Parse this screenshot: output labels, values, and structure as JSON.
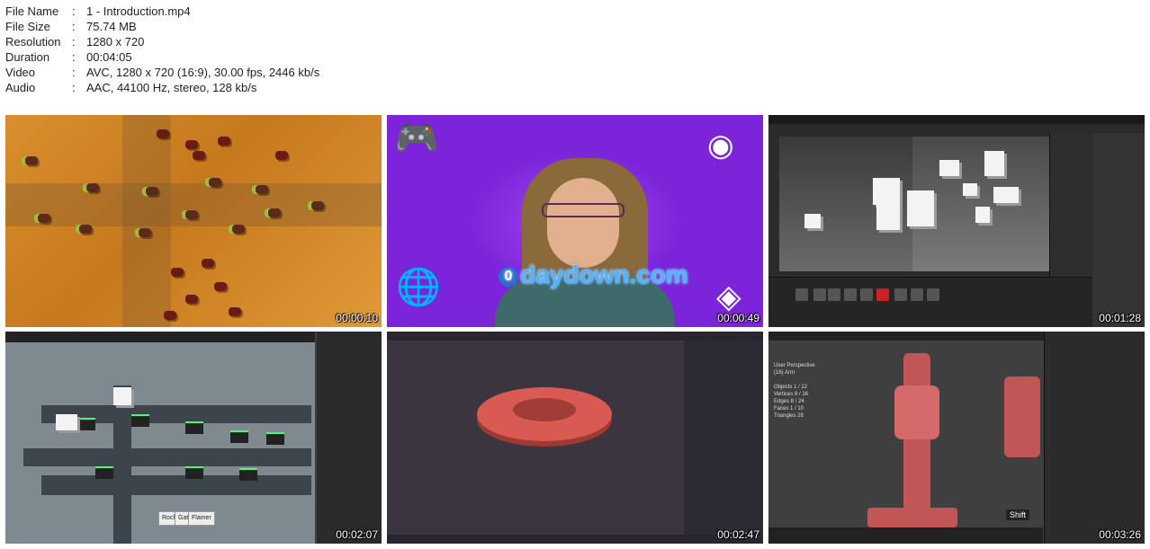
{
  "file_info": [
    {
      "label": "File Name",
      "value": "1 - Introduction.mp4"
    },
    {
      "label": "File Size",
      "value": "75.74 MB"
    },
    {
      "label": "Resolution",
      "value": "1280 x 720"
    },
    {
      "label": "Duration",
      "value": "00:04:05"
    },
    {
      "label": "Video",
      "value": "AVC, 1280 x 720 (16:9), 30.00 fps, 2446 kb/s"
    },
    {
      "label": "Audio",
      "value": "AAC, 44100 Hz, stereo, 128 kb/s"
    }
  ],
  "separator": ":",
  "thumbnails": [
    {
      "timestamp": "00:00:10"
    },
    {
      "timestamp": "00:00:49",
      "brand_text": "daydown.com",
      "brand_mark": "0"
    },
    {
      "timestamp": "00:01:28"
    },
    {
      "timestamp": "00:02:07",
      "buttons": [
        "Rocket",
        "Gatling",
        "Flamer"
      ]
    },
    {
      "timestamp": "00:02:47"
    },
    {
      "timestamp": "00:03:26",
      "key_hint": "Shift",
      "viewport_info": "User Perspective\n(16) Arm\n\nObjects 1 / 12\nVertices 8 / 16\nEdges 8 / 24\nFaces 1 / 10\nTriangles 28"
    }
  ],
  "colors": {
    "desert": "#d98f2e",
    "presenter_bg": "#7c24d9",
    "turret": "#c05656"
  }
}
